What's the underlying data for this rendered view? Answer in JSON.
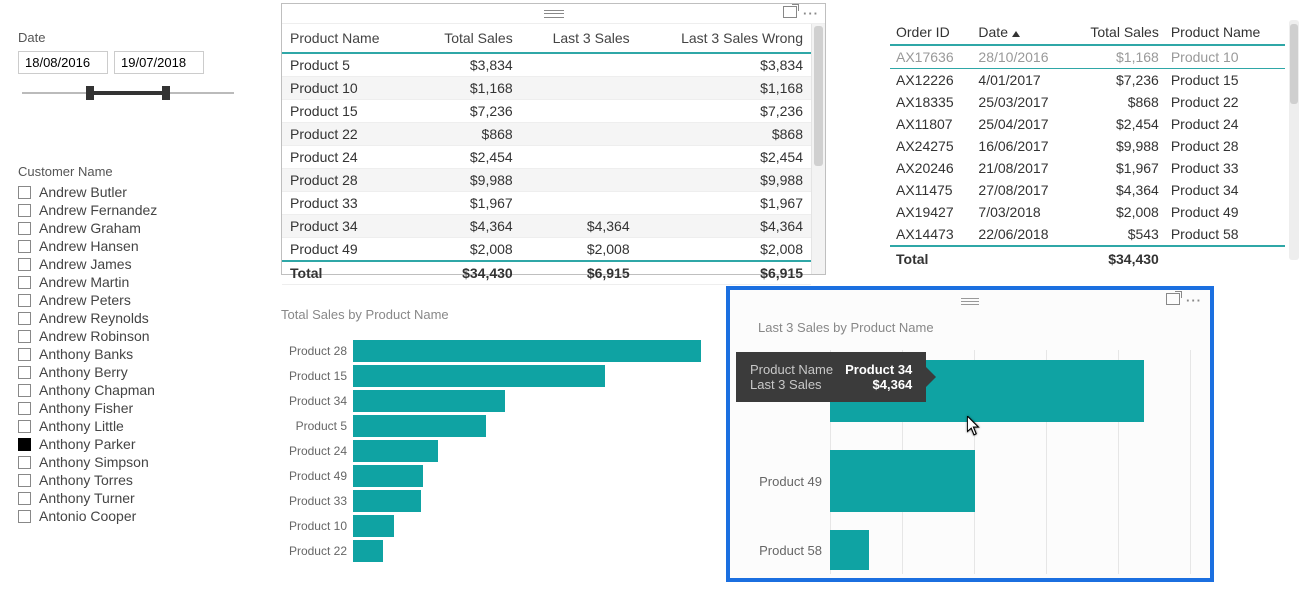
{
  "date_slicer": {
    "title": "Date",
    "from": "18/08/2016",
    "to": "19/07/2018",
    "fill_left_pct": 32,
    "fill_right_pct": 68
  },
  "customer_slicer": {
    "title": "Customer Name",
    "items": [
      {
        "label": "Andrew Butler",
        "selected": false
      },
      {
        "label": "Andrew Fernandez",
        "selected": false
      },
      {
        "label": "Andrew Graham",
        "selected": false
      },
      {
        "label": "Andrew Hansen",
        "selected": false
      },
      {
        "label": "Andrew James",
        "selected": false
      },
      {
        "label": "Andrew Martin",
        "selected": false
      },
      {
        "label": "Andrew Peters",
        "selected": false
      },
      {
        "label": "Andrew Reynolds",
        "selected": false
      },
      {
        "label": "Andrew Robinson",
        "selected": false
      },
      {
        "label": "Anthony Banks",
        "selected": false
      },
      {
        "label": "Anthony Berry",
        "selected": false
      },
      {
        "label": "Anthony Chapman",
        "selected": false
      },
      {
        "label": "Anthony Fisher",
        "selected": false
      },
      {
        "label": "Anthony Little",
        "selected": false
      },
      {
        "label": "Anthony Parker",
        "selected": true
      },
      {
        "label": "Anthony Simpson",
        "selected": false
      },
      {
        "label": "Anthony Torres",
        "selected": false
      },
      {
        "label": "Anthony Turner",
        "selected": false
      },
      {
        "label": "Antonio Cooper",
        "selected": false
      }
    ]
  },
  "product_table": {
    "columns": [
      "Product Name",
      "Total Sales",
      "Last 3 Sales",
      "Last 3 Sales Wrong"
    ],
    "rows": [
      {
        "name": "Product 5",
        "total": "$3,834",
        "l3": "",
        "l3w": "$3,834"
      },
      {
        "name": "Product 10",
        "total": "$1,168",
        "l3": "",
        "l3w": "$1,168"
      },
      {
        "name": "Product 15",
        "total": "$7,236",
        "l3": "",
        "l3w": "$7,236"
      },
      {
        "name": "Product 22",
        "total": "$868",
        "l3": "",
        "l3w": "$868"
      },
      {
        "name": "Product 24",
        "total": "$2,454",
        "l3": "",
        "l3w": "$2,454"
      },
      {
        "name": "Product 28",
        "total": "$9,988",
        "l3": "",
        "l3w": "$9,988"
      },
      {
        "name": "Product 33",
        "total": "$1,967",
        "l3": "",
        "l3w": "$1,967"
      },
      {
        "name": "Product 34",
        "total": "$4,364",
        "l3": "$4,364",
        "l3w": "$4,364"
      },
      {
        "name": "Product 49",
        "total": "$2,008",
        "l3": "$2,008",
        "l3w": "$2,008"
      }
    ],
    "totals": {
      "label": "Total",
      "total": "$34,430",
      "l3": "$6,915",
      "l3w": "$6,915"
    }
  },
  "orders_table": {
    "columns": [
      "Order ID",
      "Date",
      "Total Sales",
      "Product Name"
    ],
    "rows": [
      {
        "id": "AX17636",
        "date": "28/10/2016",
        "total": "$1,168",
        "pname": "Product 10",
        "dim": true
      },
      {
        "id": "AX12226",
        "date": "4/01/2017",
        "total": "$7,236",
        "pname": "Product 15"
      },
      {
        "id": "AX18335",
        "date": "25/03/2017",
        "total": "$868",
        "pname": "Product 22"
      },
      {
        "id": "AX11807",
        "date": "25/04/2017",
        "total": "$2,454",
        "pname": "Product 24"
      },
      {
        "id": "AX24275",
        "date": "16/06/2017",
        "total": "$9,988",
        "pname": "Product 28"
      },
      {
        "id": "AX20246",
        "date": "21/08/2017",
        "total": "$1,967",
        "pname": "Product 33"
      },
      {
        "id": "AX11475",
        "date": "27/08/2017",
        "total": "$4,364",
        "pname": "Product 34"
      },
      {
        "id": "AX19427",
        "date": "7/03/2018",
        "total": "$2,008",
        "pname": "Product 49"
      },
      {
        "id": "AX14473",
        "date": "22/06/2018",
        "total": "$543",
        "pname": "Product 58"
      }
    ],
    "totals": {
      "label": "Total",
      "total": "$34,430"
    }
  },
  "chart_data": [
    {
      "type": "bar",
      "title": "Total Sales by Product Name",
      "xlabel": "",
      "ylabel": "",
      "ylim": [
        0,
        10000
      ],
      "categories": [
        "Product 28",
        "Product 15",
        "Product 34",
        "Product 5",
        "Product 24",
        "Product 49",
        "Product 33",
        "Product 10",
        "Product 22"
      ],
      "values": [
        9988,
        7236,
        4364,
        3834,
        2454,
        2008,
        1967,
        1168,
        868
      ]
    },
    {
      "type": "bar",
      "title": "Last 3 Sales by Product Name",
      "xlabel": "",
      "ylabel": "",
      "ylim": [
        0,
        5000
      ],
      "categories": [
        "Product 34",
        "Product 49",
        "Product 58"
      ],
      "values": [
        4364,
        2008,
        543
      ]
    }
  ],
  "tooltip": {
    "rows": [
      {
        "label": "Product Name",
        "value": "Product 34"
      },
      {
        "label": "Last 3 Sales",
        "value": "$4,364"
      }
    ]
  },
  "colors": {
    "accent": "#0fa3a3",
    "select": "#1b6fe0"
  }
}
